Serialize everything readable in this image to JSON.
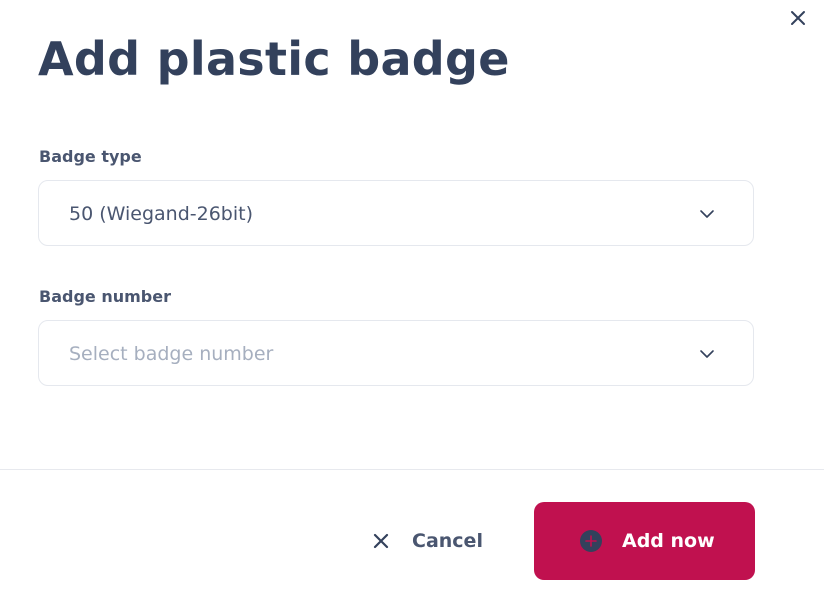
{
  "dialog": {
    "title": "Add plastic badge",
    "close_icon": "close-icon"
  },
  "fields": {
    "badge_type": {
      "label": "Badge type",
      "value": "50 (Wiegand-26bit)",
      "icon": "chevron-down-icon"
    },
    "badge_number": {
      "label": "Badge number",
      "placeholder": "Select badge number",
      "icon": "chevron-down-icon"
    }
  },
  "footer": {
    "cancel_label": "Cancel",
    "cancel_icon": "close-icon",
    "add_label": "Add now",
    "add_icon": "plus-circle-icon"
  },
  "colors": {
    "primary": "#c0114f",
    "title": "#33415c",
    "text": "#4a5670",
    "placeholder": "#a6afbf",
    "border": "#e5e8ee"
  }
}
